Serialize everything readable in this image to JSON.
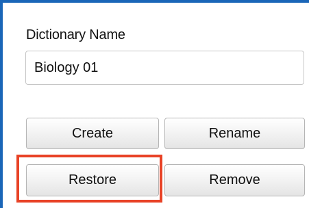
{
  "dictionary": {
    "label": "Dictionary Name",
    "name_value": "Biology 01"
  },
  "buttons": {
    "create": "Create",
    "rename": "Rename",
    "restore": "Restore",
    "remove": "Remove"
  },
  "colors": {
    "panel_border": "#1a66b8",
    "highlight": "#e84226"
  }
}
